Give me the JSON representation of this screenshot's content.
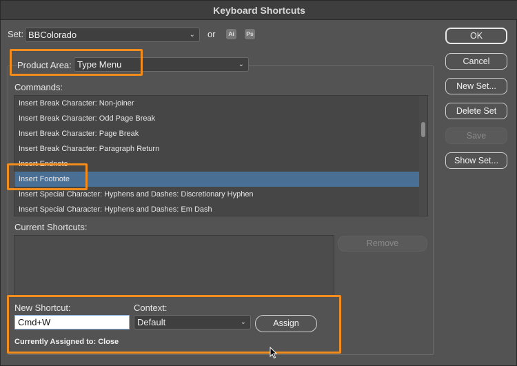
{
  "window": {
    "title": "Keyboard Shortcuts"
  },
  "set": {
    "label": "Set:",
    "value": "BBColorado",
    "or_label": "or",
    "ai_badge": "Ai",
    "ps_badge": "Ps"
  },
  "product_area": {
    "label": "Product Area:",
    "value": "Type Menu"
  },
  "commands": {
    "label": "Commands:",
    "items": [
      "Insert Break Character: Non-joiner",
      "Insert Break Character: Odd Page Break",
      "Insert Break Character: Page Break",
      "Insert Break Character: Paragraph Return",
      "Insert Endnote",
      "Insert Footnote",
      "Insert Special Character: Hyphens and Dashes: Discretionary Hyphen",
      "Insert Special Character: Hyphens and Dashes: Em Dash"
    ],
    "selected_index": 5
  },
  "current_shortcuts": {
    "label": "Current Shortcuts:",
    "remove_label": "Remove"
  },
  "new_shortcut": {
    "label": "New Shortcut:",
    "value": "Cmd+W"
  },
  "context": {
    "label": "Context:",
    "value": "Default"
  },
  "assign_label": "Assign",
  "currently_assigned": "Currently Assigned to: Close",
  "buttons": {
    "ok": "OK",
    "cancel": "Cancel",
    "new_set": "New Set...",
    "delete_set": "Delete Set",
    "save": "Save",
    "show_set": "Show Set..."
  },
  "colors": {
    "highlight": "#f28c1c",
    "selection": "#4a6f94"
  }
}
